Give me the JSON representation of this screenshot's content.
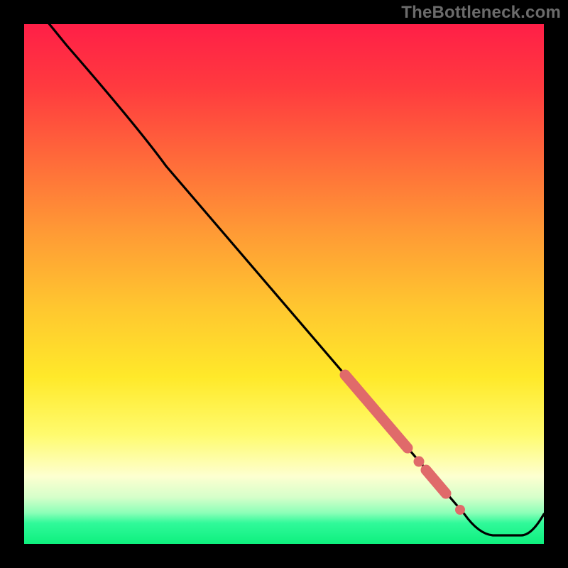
{
  "watermark": "TheBottleneck.com",
  "colors": {
    "background": "#000000",
    "curve_stroke": "#000000",
    "marker_fill": "#e57373",
    "gradient_top": "#ff1f47",
    "gradient_bottom": "#0ef07e"
  },
  "chart_data": {
    "type": "line",
    "title": "",
    "xlabel": "",
    "ylabel": "",
    "xlim": [
      0,
      100
    ],
    "ylim": [
      0,
      100
    ],
    "x": [
      0,
      5,
      10,
      15,
      20,
      25,
      30,
      35,
      40,
      45,
      50,
      55,
      60,
      65,
      70,
      75,
      80,
      85,
      87,
      90,
      92,
      95,
      100
    ],
    "values": [
      110,
      103,
      96,
      89,
      82,
      75,
      67,
      58,
      50,
      42,
      34,
      27,
      21,
      16,
      12,
      8,
      5,
      2,
      1,
      1,
      1,
      3,
      8
    ],
    "curve_note": "Main black curve descends roughly linearly from upper-left, flattens at bottom ~x=85..92, then kicks upward at far right.",
    "highlighted_segments": [
      {
        "x_start": 61,
        "x_end": 70,
        "note": "thick salmon segment along the curve"
      },
      {
        "x_start": 72,
        "x_end": 73,
        "note": "short salmon dot"
      },
      {
        "x_start": 74,
        "x_end": 78,
        "note": "salmon segment"
      },
      {
        "x_start": 80,
        "x_end": 81,
        "note": "small salmon dot"
      }
    ]
  }
}
